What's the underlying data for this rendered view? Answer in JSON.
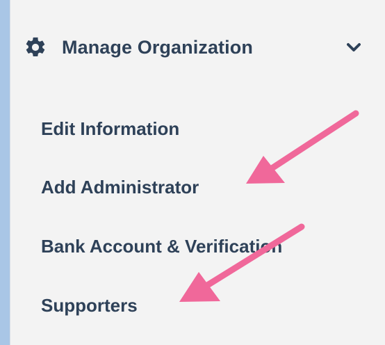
{
  "menu": {
    "header": {
      "label": "Manage Organization",
      "icon": "gear-icon",
      "toggle_icon": "chevron-down-icon"
    },
    "items": [
      {
        "label": "Edit Information"
      },
      {
        "label": "Add Administrator"
      },
      {
        "label": "Bank Account & Verification"
      },
      {
        "label": "Supporters"
      }
    ]
  },
  "annotations": {
    "arrow_color": "#f0689a",
    "panel_bg": "#f3f3f3",
    "text_color": "#2e4158",
    "frame_color": "#a9c6e6"
  }
}
